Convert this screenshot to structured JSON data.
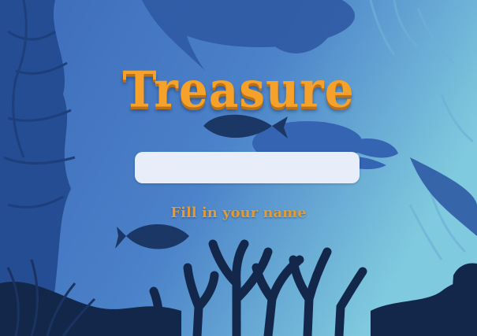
{
  "game": {
    "title": "Treasure",
    "hint": "Fill in your name"
  },
  "name_input": {
    "value": "",
    "placeholder": ""
  },
  "colors": {
    "title": "#f6a12a",
    "hint": "#e19b38",
    "water_deep": "#3a68b8",
    "water_light": "#7ecbdf",
    "silhouette": "#13274a",
    "input_bg": "#e7eef9"
  }
}
